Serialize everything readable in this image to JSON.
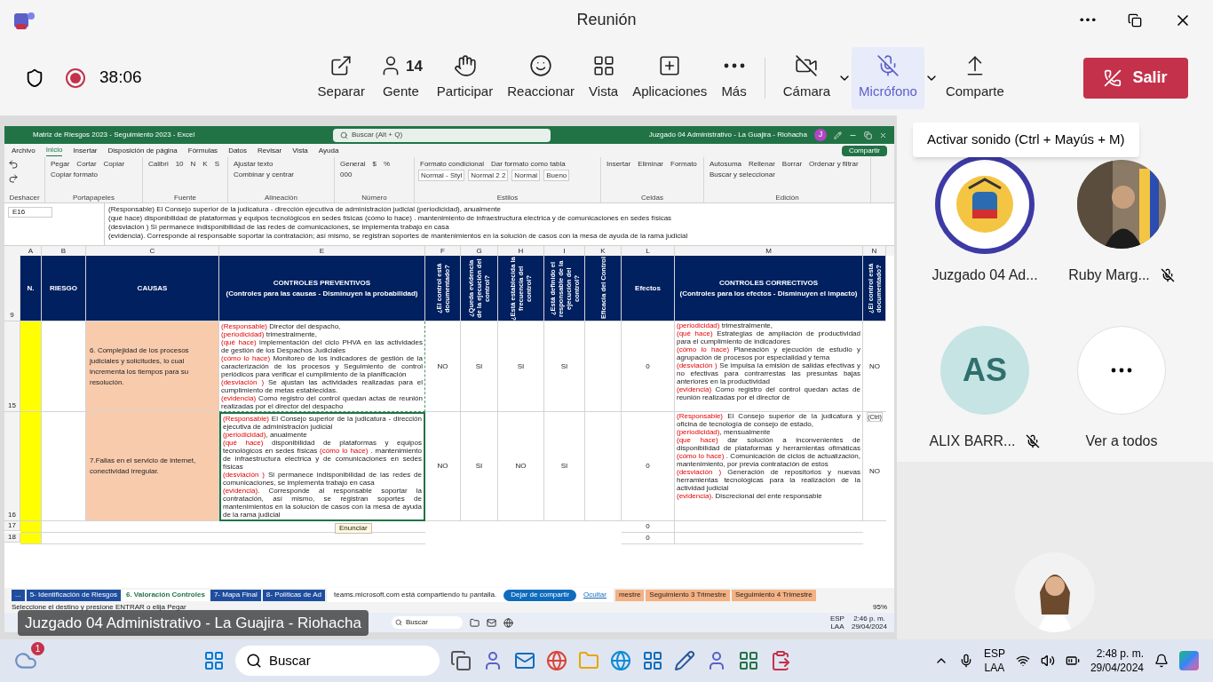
{
  "window": {
    "title": "Reunión"
  },
  "meeting": {
    "timer": "38:06",
    "recording": true
  },
  "toolbar": [
    {
      "label": "Separar",
      "highlighted": false
    },
    {
      "label": "Gente",
      "count": "14",
      "highlighted": false
    },
    {
      "label": "Participar",
      "highlighted": false
    },
    {
      "label": "Reaccionar",
      "highlighted": false
    },
    {
      "label": "Vista",
      "highlighted": false
    },
    {
      "label": "Aplicaciones",
      "highlighted": false
    },
    {
      "label": "Más",
      "highlighted": false
    }
  ],
  "devices": [
    {
      "label": "Cámara",
      "highlighted": false,
      "dropdown": true
    },
    {
      "label": "Micrófono",
      "highlighted": true,
      "dropdown": true
    },
    {
      "label": "Comparte",
      "highlighted": false,
      "dropdown": false
    }
  ],
  "leave_button": "Salir",
  "tooltip": "Activar sonido (Ctrl + Mayús + M)",
  "participants": [
    {
      "kind": "logo",
      "name": "Juzgado 04 Ad...",
      "muted": false
    },
    {
      "name": "Ruby Marg...",
      "muted": true
    },
    {
      "kind": "initials",
      "initials": "AS",
      "name": "ALIX BARR...",
      "muted": true
    },
    {
      "kind": "more",
      "name": "Ver a todos",
      "muted": false
    }
  ],
  "excel": {
    "title": "Matriz de Riesgos 2023 - Seguimiento 2023  -  Excel",
    "search": "Buscar (Alt + Q)",
    "account": "Juzgado 04 Administrativo - La Guajira - Riohacha",
    "account_initial": "J",
    "menu": [
      {
        "label": "Archivo",
        "selected": false
      },
      {
        "label": "Inicio",
        "selected": true
      },
      {
        "label": "Insertar",
        "selected": false
      },
      {
        "label": "Disposición de página",
        "selected": false
      },
      {
        "label": "Fórmulas",
        "selected": false
      },
      {
        "label": "Datos",
        "selected": false
      },
      {
        "label": "Revisar",
        "selected": false
      },
      {
        "label": "Vista",
        "selected": false
      },
      {
        "label": "Ayuda",
        "selected": false
      }
    ],
    "share_button": "Compartir",
    "ribbon": [
      {
        "label": "Deshacer"
      },
      {
        "label": "Portapapeles",
        "items": [
          "Pegar",
          "Cortar",
          "Copiar",
          "Copiar formato"
        ]
      },
      {
        "label": "Fuente",
        "items": [
          "Calibri",
          "10",
          "N",
          "K",
          "S"
        ]
      },
      {
        "label": "Alineación",
        "items": [
          "Ajustar texto",
          "Combinar y centrar"
        ]
      },
      {
        "label": "Número",
        "items": [
          "General",
          "$",
          "%",
          "000"
        ]
      },
      {
        "label": "Estilos",
        "items": [
          "Formato condicional",
          "Dar formato como tabla",
          "Normal - Styl",
          "Normal 2 2",
          "Normal",
          "Bueno"
        ]
      },
      {
        "label": "Celdas",
        "items": [
          "Insertar",
          "Eliminar",
          "Formato"
        ]
      },
      {
        "label": "Edición",
        "items": [
          "Autosuma",
          "Rellenar",
          "Borrar",
          "Ordenar y filtrar",
          "Buscar y seleccionar"
        ]
      }
    ],
    "name_box": "E16",
    "formula": [
      "(Responsable) El Consejo superior de la judicatura - dirección ejecutiva de administración judicial  (periodicidad), anualmente",
      "(qué hace)  disponibilidad de plataformas y equipos tecnológicos en sedes físicas (cómo lo hace) . mantenimiento de infraestructura electrica y de comunicaciones en sedes físicas",
      "(desviación ) Si permanece indisponibilidad de las redes de comunicaciones, se implementa trabajo en casa",
      "(evidencia). Corresponde al responsable soportar la contratación; así mismo, se registran soportes de mantenimientos en la solución de casos con la mesa de ayuda de la rama judicial"
    ],
    "columns": [
      "A",
      "B",
      "C",
      "E",
      "F",
      "G",
      "H",
      "I",
      "K",
      "L",
      "M",
      "N"
    ],
    "header_row": {
      "number": "9",
      "cells": [
        "N.",
        "RIESGO",
        "CAUSAS",
        {
          "title": "CONTROLES PREVENTIVOS",
          "subtitle": "(Controles para las causas - Disminuyen la probabilidad)"
        },
        "¿El control está documentado?",
        "¿Queda evidencia de la ejecución del control?",
        "¿Está establecida la frecuencia del control?",
        "¿Está definido el responsable de la ejecución del control?",
        "Eficacia del Control",
        "Efectos",
        {
          "title": "CONTROLES CORRECTIVOS",
          "subtitle": "(Controles para los efectos - Disminuyen el impacto)"
        },
        "¿El control está documentado?"
      ]
    },
    "rows": [
      {
        "number": "15",
        "cause": "6. Complejidad de los procesos judiciales y solicitudes, lo cual incrementa los tiempos para su resolución.",
        "preventive": [
          [
            {
              "kind": "label",
              "text": "(Responsable)"
            },
            {
              "kind": "text",
              "text": " Director del despacho,"
            }
          ],
          [
            {
              "kind": "label",
              "text": "(periodicidad)"
            },
            {
              "kind": "text",
              "text": " trimestralmente,"
            }
          ],
          [
            {
              "kind": "label",
              "text": "(qué hace)"
            },
            {
              "kind": "text",
              "text": " implementación del ciclo PHVA en las actividades de gestión de los Despachos Judiciales"
            }
          ],
          [
            {
              "kind": "label",
              "text": "(cómo lo hace)"
            },
            {
              "kind": "text",
              "text": " Monitoreo de los indicadores de gestión de la caracterización de los procesos y Seguimiento de control periódicos para verificar el cumplimiento de la planificación"
            }
          ],
          [
            {
              "kind": "label",
              "text": "(desviación )"
            },
            {
              "kind": "text",
              "text": " Se ajustan las actividades realizadas para el cumplimiento de metas establecidas."
            }
          ],
          [
            {
              "kind": "label",
              "text": "(evidencia)"
            },
            {
              "kind": "text",
              "text": " Como registro del control quedan actas de reunión realizadas por el director del despacho"
            }
          ]
        ],
        "checks": [
          "NO",
          "SI",
          "SI",
          "SI"
        ],
        "effects": "0",
        "corrective": [
          [
            {
              "kind": "label",
              "text": "(periodicidad)"
            },
            {
              "kind": "text",
              "text": " trimestralmente,"
            }
          ],
          [
            {
              "kind": "label",
              "text": "(qué hace)"
            },
            {
              "kind": "text",
              "text": " Estrategias de ampliación de productividad para el cumplimiento de indicadores"
            }
          ],
          [
            {
              "kind": "label",
              "text": "(cómo lo hace)"
            },
            {
              "kind": "text",
              "text": " Planeación y ejecución de estudio y agrupación de procesos por especialidad y tema"
            }
          ],
          [
            {
              "kind": "label",
              "text": "(desviación )"
            },
            {
              "kind": "text",
              "text": " Se impulsa la emisión de salidas efectivas y no efectivas para contrarrestas las presuntas bajas anteriores en la productividad"
            }
          ],
          [
            {
              "kind": "label",
              "text": "(evidencia)"
            },
            {
              "kind": "text",
              "text": " Como registro del control quedan actas de reunión realizadas por el director de"
            }
          ]
        ],
        "documented": "NO",
        "selected": false
      },
      {
        "number": "16",
        "cause": "7.Fallas en el servicio de internet,  conectividad  irregular.",
        "preventive": [
          [
            {
              "kind": "label",
              "text": "(Responsable)"
            },
            {
              "kind": "text",
              "text": " El Consejo superior de la judicatura - dirección ejecutiva de administración judicial"
            }
          ],
          [
            {
              "kind": "label",
              "text": "(periodicidad)"
            },
            {
              "kind": "text",
              "text": ", anualmente"
            }
          ],
          [
            {
              "kind": "label",
              "text": "(qué hace)"
            },
            {
              "kind": "text",
              "text": " disponibilidad de plataformas y equipos tecnológicos en sedes físicas "
            },
            {
              "kind": "label",
              "text": "(cómo lo hace)"
            },
            {
              "kind": "text",
              "text": " . mantenimiento de infraestructura electrica y de comunicaciones en sedes físicas"
            }
          ],
          [
            {
              "kind": "label",
              "text": "(desviación )"
            },
            {
              "kind": "text",
              "text": " Si permanece indisponibilidad de las redes de comunicaciones, se implementa trabajo en casa"
            }
          ],
          [
            {
              "kind": "label",
              "text": "(evidencia)"
            },
            {
              "kind": "text",
              "text": ". Corresponde al responsable soportar la contratación, así mismo, se registran soportes de mantenimientos en la solución de casos con la mesa de ayuda de la rama judicial"
            }
          ]
        ],
        "checks": [
          "NO",
          "SI",
          "NO",
          "SI"
        ],
        "effects": "0",
        "corrective": [
          [
            {
              "kind": "label",
              "text": "(Responsable)"
            },
            {
              "kind": "text",
              "text": " El Consejo superior de la judicatura y oficina de tecnología de consejo de estado,"
            }
          ],
          [
            {
              "kind": "label",
              "text": "(periodicidad)"
            },
            {
              "kind": "text",
              "text": ", mensualmente"
            }
          ],
          [
            {
              "kind": "label",
              "text": "(que hace)"
            },
            {
              "kind": "text",
              "text": " dar solución a inconvenientes de disponibilidad de plataformas y herramientas ofimáticas "
            },
            {
              "kind": "label",
              "text": "(cómo lo hace)"
            },
            {
              "kind": "text",
              "text": " . Comunicación de ciclos de actualización, mantenimiento, por previa contratación de estos"
            }
          ],
          [
            {
              "kind": "label",
              "text": "(desviación )"
            },
            {
              "kind": "text",
              "text": " Generación de repositorios y nuevas herramientas tecnológicas para la realización de la actividad judicial"
            }
          ],
          [
            {
              "kind": "label",
              "text": "(evidencia)"
            },
            {
              "kind": "text",
              "text": ". Discrecional del ente responsable"
            }
          ]
        ],
        "documented": "NO",
        "selected": true
      }
    ],
    "paste_chip": "(Ctrl)",
    "empty_rows": [
      {
        "number": "17",
        "effects": "0"
      },
      {
        "number": "18",
        "effects": "0"
      }
    ],
    "tooltip": "Enunciar",
    "sheets_before": [
      {
        "label": "...",
        "selected": false
      },
      {
        "label": "5- Identificación de Riesgos",
        "selected": false
      },
      {
        "label": "6. Valoración Controles",
        "selected": true
      },
      {
        "label": "7- Mapa Final",
        "selected": false
      },
      {
        "label": "8- Políticas de Ad",
        "selected": false
      }
    ],
    "share_bar": {
      "message": "teams.microsoft.com está compartiendo tu pantalla.",
      "stop": "Dejar de compartir",
      "hide": "Ocultar"
    },
    "sheets_after": [
      {
        "label": "mestre",
        "selected": false
      },
      {
        "label": "Seguimiento 3 Trimestre",
        "selected": false
      },
      {
        "label": "Seguimiento 4 Trimestre",
        "selected": false
      }
    ],
    "status": "Seleccione el destino y presione ENTRAR o elija Pegar",
    "zoom": "95%",
    "inner_taskbar": {
      "search": "Buscar",
      "lang": "ESP",
      "region": "LAA",
      "time": "2:46 p. m.",
      "date": "29/04/2024"
    }
  },
  "presenter_label": "Juzgado 04 Administrativo - La Guajira - Riohacha",
  "taskbar": {
    "badge": "1",
    "search": "Buscar",
    "lang": "ESP",
    "region": "LAA",
    "time": "2:48 p. m.",
    "date": "29/04/2024"
  }
}
